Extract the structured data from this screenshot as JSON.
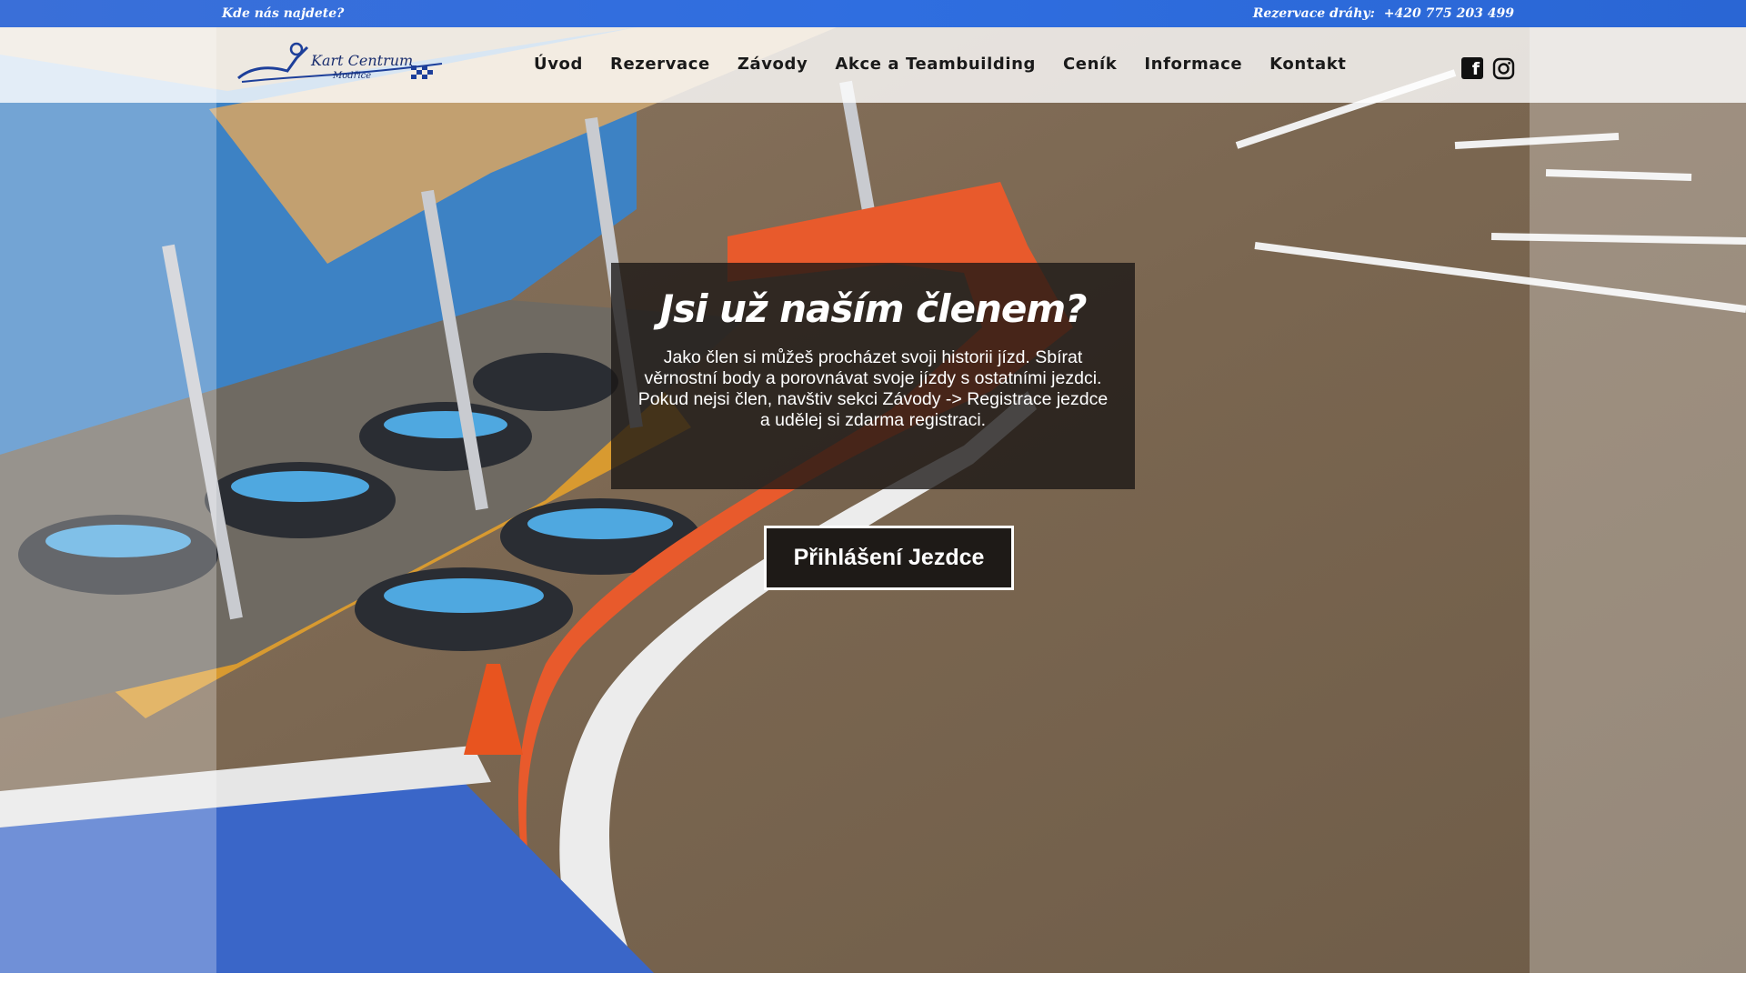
{
  "topbar": {
    "where_label": "Kde nás najdete?",
    "reservation_label": "Rezervace dráhy:",
    "phone": "+420 775 203 499"
  },
  "brand": {
    "logo_text_line1": "Kart Centrum",
    "logo_text_line2": "Modřice"
  },
  "nav": {
    "items": [
      {
        "label": "Úvod"
      },
      {
        "label": "Rezervace"
      },
      {
        "label": "Závody"
      },
      {
        "label": "Akce a Teambuilding"
      },
      {
        "label": "Ceník"
      },
      {
        "label": "Informace"
      },
      {
        "label": "Kontakt"
      }
    ]
  },
  "social": {
    "facebook_icon": "facebook-icon",
    "instagram_icon": "instagram-icon"
  },
  "member": {
    "title": "Jsi už naším členem?",
    "text": "Jako člen si můžeš procházet svoji historii jízd. Sbírat věrnostní body a porovnávat svoje jízdy s ostatními jezdci. Pokud nejsi člen, navštiv sekci Závody -> Registrace jezdce a udělej si zdarma registraci."
  },
  "cta": {
    "label": "Přihlášení Jezdce"
  },
  "colors": {
    "topbar": "#2f6ee0",
    "box_bg": "#191614",
    "button_bg": "#1e1a17"
  }
}
